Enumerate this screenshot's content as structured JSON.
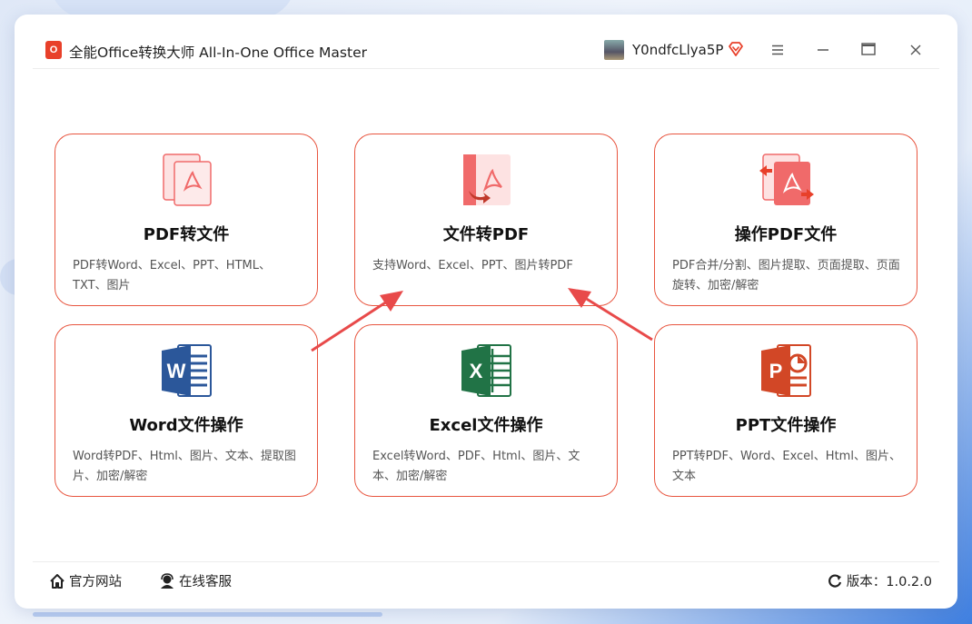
{
  "app": {
    "title": "全能Office转换大师 All-In-One Office Master",
    "logo_text": "O"
  },
  "user": {
    "name": "Y0ndfcLlya5P"
  },
  "window_controls": [
    "menu-icon",
    "minimize-icon",
    "maximize-icon",
    "close-icon"
  ],
  "cards": [
    {
      "title": "PDF转文件",
      "desc": "PDF转Word、Excel、PPT、HTML、TXT、图片",
      "icon": "pdf-to-file-icon"
    },
    {
      "title": "文件转PDF",
      "desc": "支持Word、Excel、PPT、图片转PDF",
      "icon": "file-to-pdf-icon"
    },
    {
      "title": "操作PDF文件",
      "desc": "PDF合并/分割、图片提取、页面提取、页面旋转、加密/解密",
      "icon": "pdf-operations-icon"
    },
    {
      "title": "Word文件操作",
      "desc": "Word转PDF、Html、图片、文本、提取图片、加密/解密",
      "icon": "word-icon"
    },
    {
      "title": "Excel文件操作",
      "desc": "Excel转Word、PDF、Html、图片、文本、加密/解密",
      "icon": "excel-icon"
    },
    {
      "title": "PPT文件操作",
      "desc": "PPT转PDF、Word、Excel、Html、图片、文本",
      "icon": "powerpoint-icon"
    }
  ],
  "footer": {
    "website_label": "官方网站",
    "support_label": "在线客服",
    "version_label": "版本：1.0.2.0"
  },
  "colors": {
    "accent": "#e8553f",
    "pdf_red": "#f06a6a",
    "word_blue": "#2b579a",
    "excel_green": "#217346",
    "ppt_orange": "#d24726"
  }
}
